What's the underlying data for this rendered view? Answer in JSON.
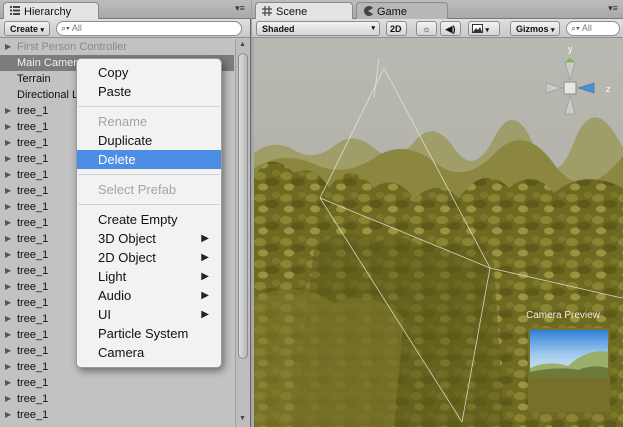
{
  "hierarchy": {
    "tab_label": "Hierarchy",
    "tab_icon": "list-icon",
    "create_label": "Create",
    "search_placeholder": "All",
    "items": [
      {
        "label": "First Person Controller",
        "expandable": true,
        "dim": true
      },
      {
        "label": "Main Camera",
        "expandable": false,
        "selected": true
      },
      {
        "label": "Terrain",
        "expandable": false
      },
      {
        "label": "Directional Light",
        "expandable": false
      },
      {
        "label": "tree_1",
        "expandable": true
      },
      {
        "label": "tree_1",
        "expandable": true
      },
      {
        "label": "tree_1",
        "expandable": true
      },
      {
        "label": "tree_1",
        "expandable": true
      },
      {
        "label": "tree_1",
        "expandable": true
      },
      {
        "label": "tree_1",
        "expandable": true
      },
      {
        "label": "tree_1",
        "expandable": true
      },
      {
        "label": "tree_1",
        "expandable": true
      },
      {
        "label": "tree_1",
        "expandable": true
      },
      {
        "label": "tree_1",
        "expandable": true
      },
      {
        "label": "tree_1",
        "expandable": true
      },
      {
        "label": "tree_1",
        "expandable": true
      },
      {
        "label": "tree_1",
        "expandable": true
      },
      {
        "label": "tree_1",
        "expandable": true
      },
      {
        "label": "tree_1",
        "expandable": true
      },
      {
        "label": "tree_1",
        "expandable": true
      },
      {
        "label": "tree_1",
        "expandable": true
      },
      {
        "label": "tree_1",
        "expandable": true
      },
      {
        "label": "tree_1",
        "expandable": true
      },
      {
        "label": "tree_1",
        "expandable": true
      }
    ]
  },
  "context_menu": {
    "groups": [
      [
        {
          "label": "Copy",
          "enabled": true
        },
        {
          "label": "Paste",
          "enabled": true
        }
      ],
      [
        {
          "label": "Rename",
          "enabled": false
        },
        {
          "label": "Duplicate",
          "enabled": true
        },
        {
          "label": "Delete",
          "enabled": true,
          "highlighted": true
        }
      ],
      [
        {
          "label": "Select Prefab",
          "enabled": false
        }
      ],
      [
        {
          "label": "Create Empty",
          "enabled": true
        },
        {
          "label": "3D Object",
          "enabled": true,
          "submenu": true
        },
        {
          "label": "2D Object",
          "enabled": true,
          "submenu": true
        },
        {
          "label": "Light",
          "enabled": true,
          "submenu": true
        },
        {
          "label": "Audio",
          "enabled": true,
          "submenu": true
        },
        {
          "label": "UI",
          "enabled": true,
          "submenu": true
        },
        {
          "label": "Particle System",
          "enabled": true
        },
        {
          "label": "Camera",
          "enabled": true
        }
      ]
    ]
  },
  "scene": {
    "tabs": [
      {
        "label": "Scene",
        "icon": "grid-icon",
        "active": true
      },
      {
        "label": "Game",
        "icon": "pacman-icon",
        "active": false
      }
    ],
    "shading_mode": "Shaded",
    "mode_2d_label": "2D",
    "lighting_icon": "sun-icon",
    "audio_icon": "speaker-icon",
    "effects_icon": "image-icon",
    "gizmos_label": "Gizmos",
    "search_placeholder": "All",
    "gizmo_axes": {
      "y": "y",
      "z": "z"
    },
    "camera_preview_label": "Camera Preview"
  },
  "colors": {
    "selection_blue": "#4b8ee3",
    "panel_bg": "#c2c2c2",
    "foliage": "#77702a"
  }
}
